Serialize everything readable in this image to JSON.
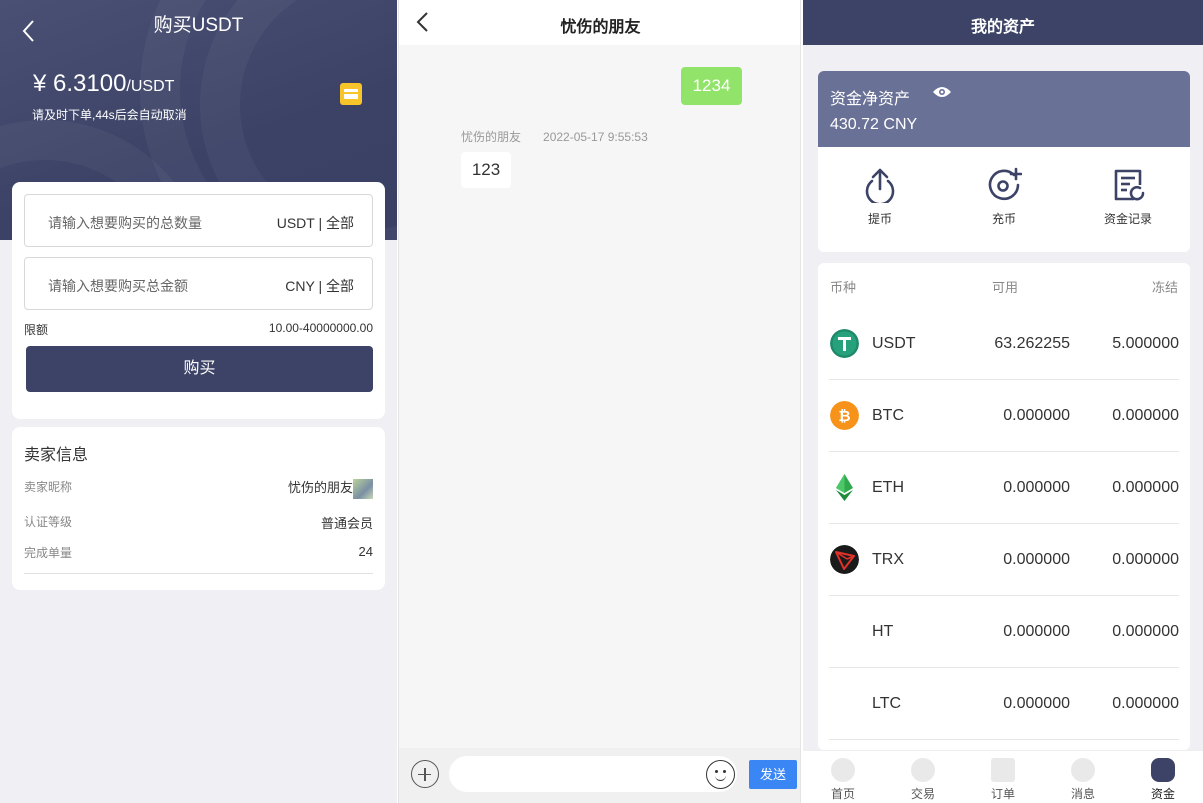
{
  "buy": {
    "title": "购买USDT",
    "price": "¥ 6.3100",
    "price_unit": "/USDT",
    "tip": "请及时下单,44s后会自动取消",
    "qty_placeholder": "请输入想要购买的总数量",
    "qty_unit": "USDT",
    "qty_all": "全部",
    "amount_placeholder": "请输入想要购买总金额",
    "amount_unit": "CNY",
    "amount_all": "全部",
    "separator": "|",
    "limit_label": "限额",
    "limit_value": "10.00-40000000.00",
    "buy_button": "购买",
    "seller": {
      "title": "卖家信息",
      "nickname_label": "卖家昵称",
      "nickname": "忧伤的朋友",
      "level_label": "认证等级",
      "level": "普通会员",
      "orders_label": "完成单量",
      "orders": "24"
    }
  },
  "chat": {
    "title": "忧伤的朋友",
    "messages": [
      {
        "from": "me",
        "text": "1234"
      },
      {
        "from": "other",
        "sender": "忧伤的朋友",
        "time": "2022-05-17 9:55:53",
        "text": "123"
      }
    ],
    "send_button": "发送",
    "input_value": ""
  },
  "assets": {
    "title": "我的资产",
    "net_label": "资金净资产",
    "net_value": "430.72 CNY",
    "actions": [
      {
        "icon": "withdraw-icon",
        "label": "提币"
      },
      {
        "icon": "deposit-icon",
        "label": "充币"
      },
      {
        "icon": "records-icon",
        "label": "资金记录"
      }
    ],
    "columns": [
      "币种",
      "可用",
      "冻结"
    ],
    "coins": [
      {
        "name": "USDT",
        "available": "63.262255",
        "frozen": "5.000000",
        "icon": "usdt-icon",
        "color": "#26a17b"
      },
      {
        "name": "BTC",
        "available": "0.000000",
        "frozen": "0.000000",
        "icon": "btc-icon",
        "color": "#f7931a"
      },
      {
        "name": "ETH",
        "available": "0.000000",
        "frozen": "0.000000",
        "icon": "eth-icon",
        "color": "#30a94c"
      },
      {
        "name": "TRX",
        "available": "0.000000",
        "frozen": "0.000000",
        "icon": "trx-icon",
        "color": "#1a1a1a"
      },
      {
        "name": "HT",
        "available": "0.000000",
        "frozen": "0.000000",
        "icon": "",
        "color": ""
      },
      {
        "name": "LTC",
        "available": "0.000000",
        "frozen": "0.000000",
        "icon": "",
        "color": ""
      }
    ],
    "tabs": [
      {
        "label": "首页",
        "icon": "home-icon",
        "active": false
      },
      {
        "label": "交易",
        "icon": "trade-icon",
        "active": false
      },
      {
        "label": "订单",
        "icon": "orders-icon",
        "active": false
      },
      {
        "label": "消息",
        "icon": "messages-icon",
        "active": false
      },
      {
        "label": "资金",
        "icon": "funds-icon",
        "active": true
      }
    ]
  },
  "colors": {
    "primary": "#3c4366",
    "asset_header": "#6a7197",
    "send": "#3b86f5",
    "bubble_me": "#92e36a"
  }
}
